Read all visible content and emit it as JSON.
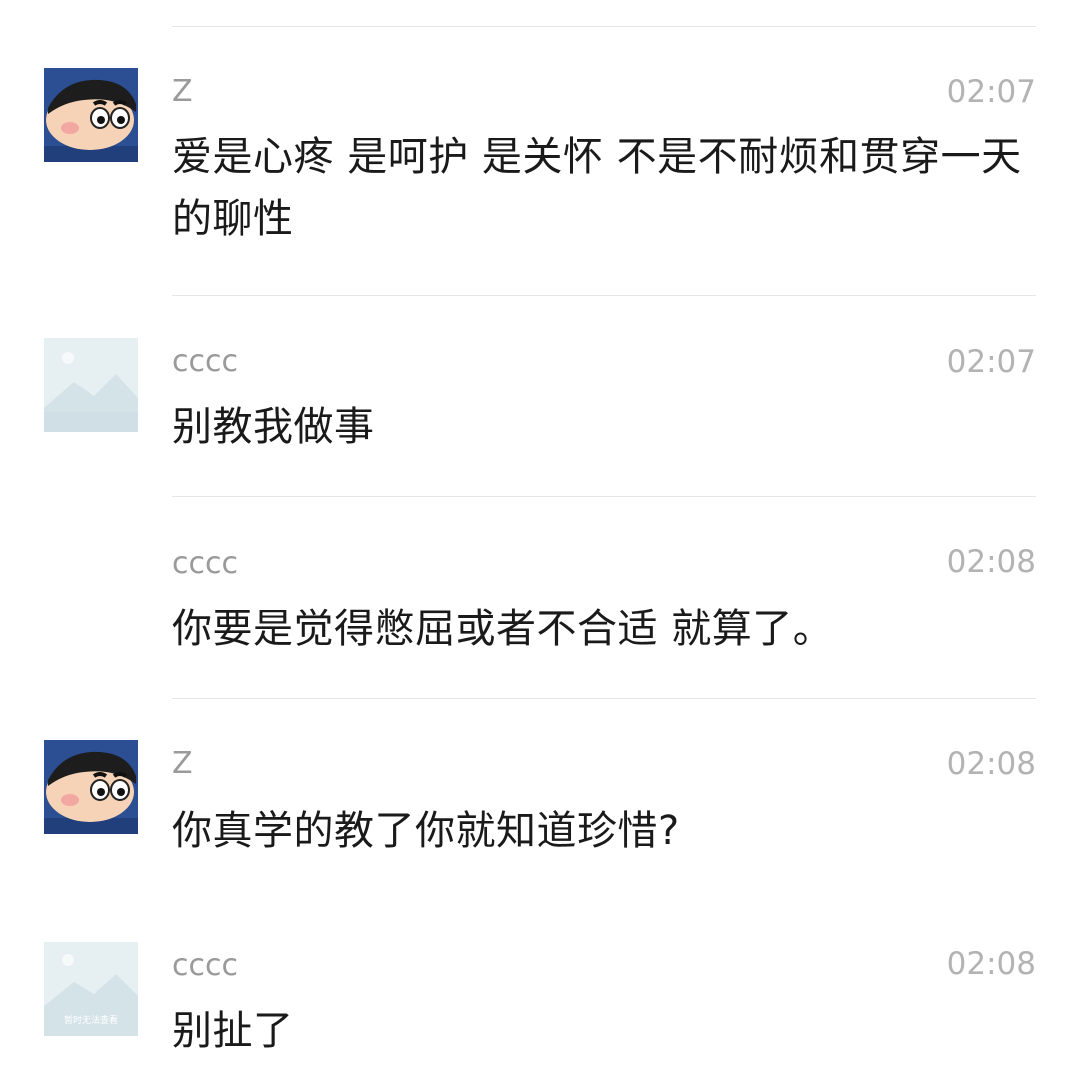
{
  "messages": [
    {
      "sender": "Z",
      "time": "02:07",
      "text": "爱是心疼 是呵护 是关怀 不是不耐烦和贯穿一天的聊性",
      "avatar": "cartoon-boy-icon"
    },
    {
      "sender": "cccc",
      "time": "02:07",
      "text": "别教我做事",
      "avatar": "image-placeholder-icon"
    },
    {
      "sender": "cccc",
      "time": "02:08",
      "text": "你要是觉得憋屈或者不合适 就算了。",
      "avatar": ""
    },
    {
      "sender": "Z",
      "time": "02:08",
      "text": "你真学的教了你就知道珍惜?",
      "avatar": "cartoon-boy-icon"
    },
    {
      "sender": "cccc",
      "time": "02:08",
      "text": "别扯了",
      "avatar": "image-placeholder-icon",
      "avatar_caption": "暂时无法查看"
    }
  ],
  "colors": {
    "divider": "#e6e6e6",
    "meta_text": "#9a9a9a",
    "body_text": "#1a1a1a",
    "avatar_frame": "#2b4f92"
  }
}
